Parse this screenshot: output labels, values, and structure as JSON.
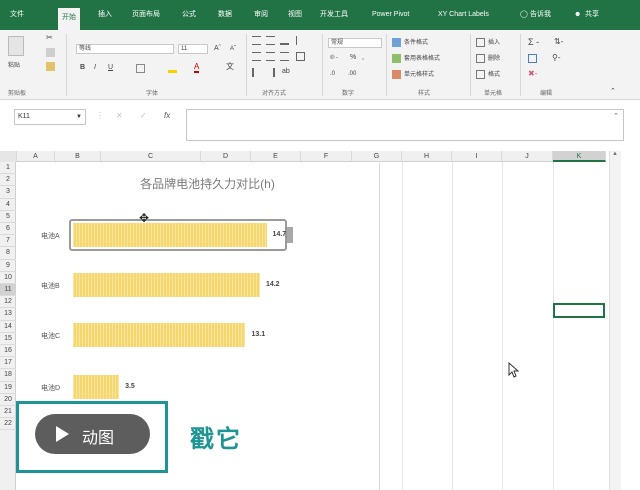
{
  "menubar": {
    "items": [
      "文件",
      "开始",
      "插入",
      "页面布局",
      "公式",
      "数据",
      "审阅",
      "视图",
      "开发工具",
      "Power Pivot",
      "XY Chart Labels",
      "告诉我",
      "共享"
    ],
    "active_index": 1
  },
  "ribbon": {
    "clipboard": {
      "cut": "✂",
      "paste": "粘贴",
      "label": "剪贴板"
    },
    "font": {
      "name": "等线",
      "size": "11",
      "label": "字体"
    },
    "alignment": {
      "label": "对齐方式"
    },
    "number": {
      "format": "常规",
      "label": "数字"
    },
    "styles": {
      "conditional": "条件格式",
      "table": "套用表格格式",
      "cell": "单元格样式",
      "label": "样式"
    },
    "cells": {
      "insert": "插入",
      "delete": "删除",
      "format": "格式",
      "label": "单元格"
    },
    "editing": {
      "label": "编辑"
    }
  },
  "formula_bar": {
    "name_box": "K11",
    "fx": "fx",
    "value": ""
  },
  "columns": [
    "A",
    "B",
    "C",
    "D",
    "E",
    "F",
    "G",
    "H",
    "I",
    "J",
    "K"
  ],
  "selected_column": "K",
  "rows": [
    "1",
    "2",
    "3",
    "4",
    "5",
    "6",
    "7",
    "8",
    "9",
    "10",
    "11",
    "12",
    "13",
    "14",
    "15",
    "16",
    "17",
    "18",
    "19",
    "20",
    "21",
    "22"
  ],
  "selected_row": "11",
  "chart_data": {
    "type": "bar",
    "title": "各品牌电池持久力对比(h)",
    "categories": [
      "电池A",
      "电池B",
      "电池C",
      "电池D"
    ],
    "values": [
      14.7,
      14.2,
      13.1,
      3.5
    ],
    "xlim": [
      0,
      18
    ],
    "bar_color": "#f5d76e",
    "battery_outline_color": "#9a9a9a",
    "grid": false
  },
  "overlay": {
    "play_label": "动图",
    "side_text": "戳它",
    "accent": "#1f9494"
  }
}
